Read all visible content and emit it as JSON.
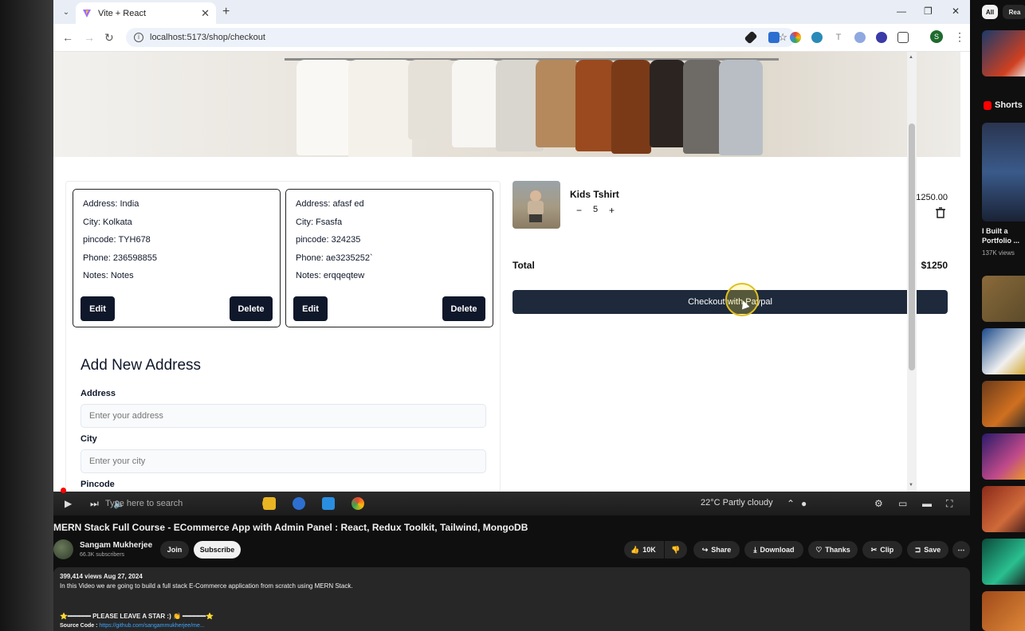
{
  "browser": {
    "tab_title": "Vite + React",
    "tab_close": "✕",
    "new_tab": "+",
    "url": "localhost:5173/shop/checkout",
    "profile_initial": "S"
  },
  "addresses": [
    {
      "address": "Address: India",
      "city": "City: Kolkata",
      "pincode": "pincode: TYH678",
      "phone": "Phone: 236598855",
      "notes": "Notes: Notes",
      "edit": "Edit",
      "delete": "Delete"
    },
    {
      "address": "Address: afasf ed",
      "city": "City: Fsasfa",
      "pincode": "pincode: 324235",
      "phone": "Phone: ae3235252`",
      "notes": "Notes: erqqeqtew",
      "edit": "Edit",
      "delete": "Delete"
    }
  ],
  "form": {
    "title": "Add New Address",
    "address_label": "Address",
    "address_placeholder": "Enter your address",
    "city_label": "City",
    "city_placeholder": "Enter your city",
    "pincode_label": "Pincode"
  },
  "cart": {
    "item_name": "Kids Tshirt",
    "minus": "−",
    "quantity": "5",
    "plus": "+",
    "price": "$1250.00",
    "total_label": "Total",
    "total_value": "$1250",
    "checkout_label": "Checkout with Paypal"
  },
  "taskbar": {
    "search_placeholder": "Type here to search",
    "weather": "22°C  Partly cloudy"
  },
  "video": {
    "title": "MERN Stack Full Course - ECommerce App with Admin Panel : React, Redux Toolkit, Tailwind, MongoDB",
    "channel": "Sangam Mukherjee",
    "subscribers": "66.3K subscribers",
    "join": "Join",
    "subscribe": "Subscribe",
    "likes": "10K",
    "share": "Share",
    "download": "Download",
    "thanks": "Thanks",
    "clip": "Clip",
    "save": "Save",
    "meta": "399,414 views  Aug 27, 2024",
    "description": "In this Video we are going to build a full stack E-Commerce application from scratch using MERN Stack.",
    "star_line": "⭐━━━━━━ PLEASE LEAVE A STAR :) 👏 ━━━━━━⭐",
    "source_label": "Source Code : ",
    "source_link": "https://github.com/sangammukherjee/me..."
  },
  "sidebar": {
    "chip_all": "All",
    "chip_related": "Rea",
    "shorts_label": "Shorts",
    "short_title": "I Built a Portfolio ...",
    "short_views": "137K views"
  },
  "colors": {
    "primary_dark": "#0f172a",
    "checkout_button": "#1e293b",
    "yt_background": "#0f0f0f"
  }
}
